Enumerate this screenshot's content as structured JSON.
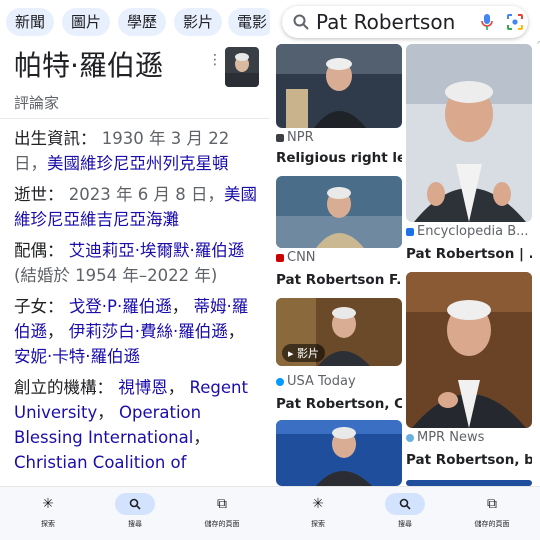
{
  "left": {
    "chips": [
      "新聞",
      "圖片",
      "學歷",
      "影片",
      "電影"
    ],
    "title": "帕特·羅伯遜",
    "subtitle": "評論家",
    "facts": [
      {
        "label": "出生資訊：",
        "value": " 1930 年 3 月 22 日，",
        "links": [
          "美國維珍尼亞州列克星頓"
        ],
        "tail": ""
      },
      {
        "label": "逝世：",
        "value": " 2023 年 6 月 8 日，",
        "links": [
          "美國維珍尼亞維吉尼亞海灘"
        ],
        "tail": ""
      },
      {
        "label": "配偶：",
        "value": " ",
        "links": [
          "艾迪莉亞·埃爾默·羅伯遜"
        ],
        "tail": " (結婚於 1954 年–2022 年)"
      },
      {
        "label": "子女：",
        "value": " ",
        "links": [
          "戈登·P·羅伯遜",
          "蒂姆·羅伯遜",
          "伊莉莎白·費絲·羅伯遜",
          "安妮·卡特·羅伯遜"
        ],
        "tail": ""
      },
      {
        "label": "創立的機構：",
        "value": " ",
        "links": [
          "視博恩",
          "Regent University",
          "Operation Blessing International",
          "Christian Coalition of"
        ],
        "tail": ""
      }
    ],
    "nav": {
      "discover": "探索",
      "search": "搜尋",
      "saved": "儲存的頁面"
    }
  },
  "right": {
    "query": "Pat Robertson",
    "cards_left": [
      {
        "source": "NPR",
        "title": "Religious right le...",
        "source_color": "#3c4043"
      },
      {
        "source": "CNN",
        "title": "Pat Robertson F...",
        "source_color": "#cc0000"
      },
      {
        "source": "USA Today",
        "title": "Pat Robertson, C...",
        "source_color": "#009bff",
        "badge": "影片"
      }
    ],
    "cards_right": [
      {
        "source": "Encyclopedia B...",
        "title": "Pat Robertson | ...",
        "source_color": "#1a73e8"
      },
      {
        "source": "MPR News",
        "title": "Pat Robertson, b...",
        "source_color": "#6ab0de"
      }
    ],
    "nav": {
      "discover": "探索",
      "search": "搜尋",
      "saved": "儲存的頁面"
    }
  },
  "colors": {
    "link": "#1a0dab",
    "chip_bg": "#e8f0fe",
    "nav_active": "#d3e3fd"
  }
}
